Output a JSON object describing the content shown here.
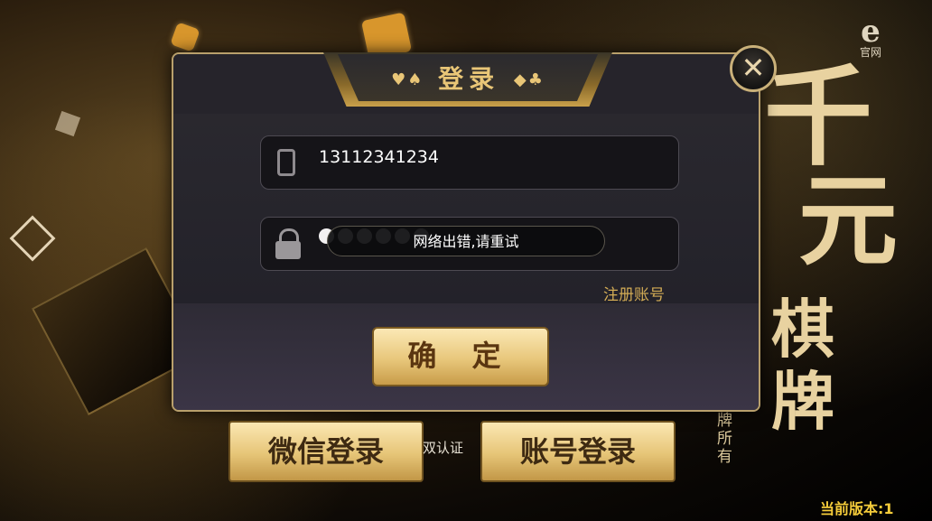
{
  "background": {
    "brand_chars": [
      "千",
      "元",
      "棋",
      "牌"
    ],
    "owner_text": "牌所有",
    "official_label": "官网",
    "official_icon": "e-logo-icon"
  },
  "dialog": {
    "title": "登录",
    "title_suits_left": "♥♠",
    "title_suits_right": "◆♣",
    "close_icon": "close-icon",
    "phone_field": {
      "icon": "phone-icon",
      "value": "13112341234"
    },
    "password_field": {
      "icon": "lock-icon",
      "masked_length": 6
    },
    "toast_message": "网络出错,请重试",
    "register_link": "注册账号",
    "confirm_label": "确 定"
  },
  "footer": {
    "wechat_login": "微信登录",
    "account_login": "账号登录",
    "double_cert_text": "双认证",
    "version_text": "当前版本:1"
  },
  "colors": {
    "gold_text": "#e9c677",
    "gold_button": "#e8c77b",
    "version_yellow": "#f5cc3a",
    "dialog_bg": "#26242b"
  }
}
